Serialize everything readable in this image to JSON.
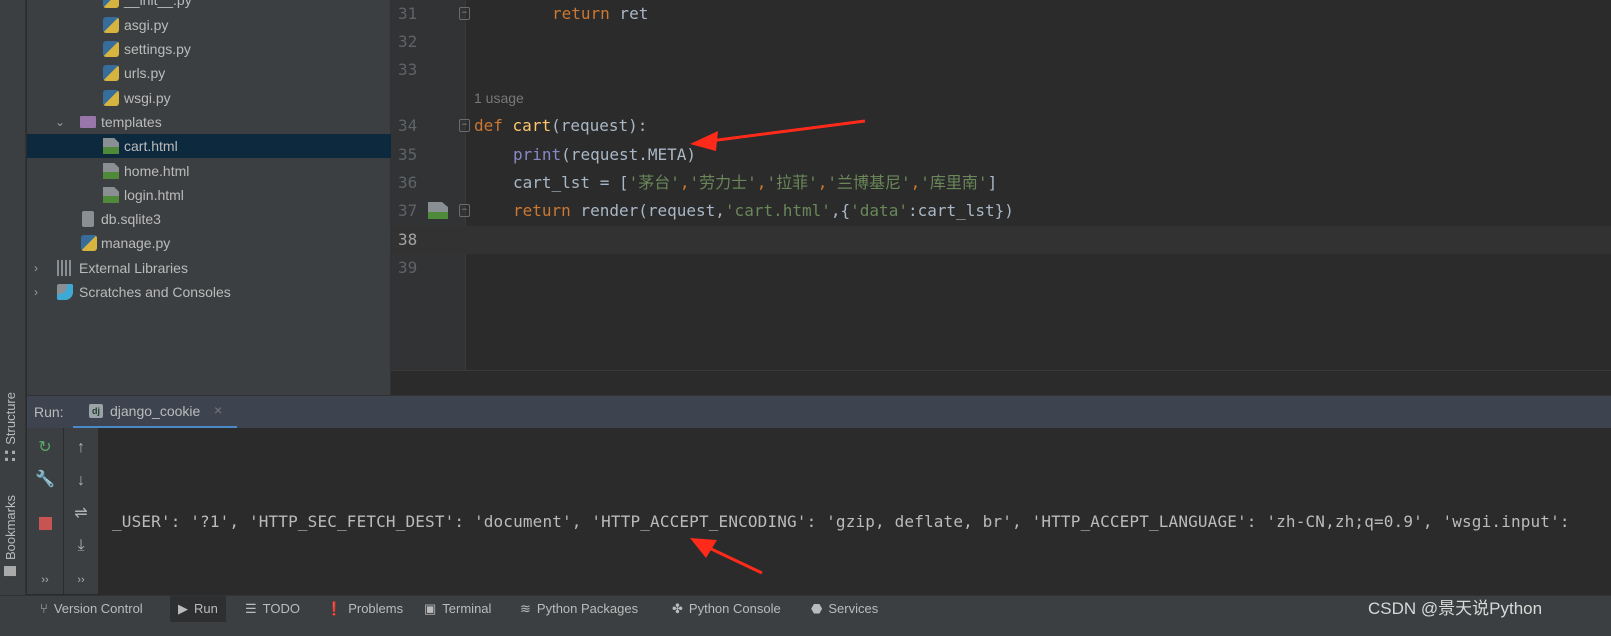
{
  "left_strip": {
    "structure": "Structure",
    "bookmarks": "Bookmarks"
  },
  "project_tree": [
    {
      "label": "__init__.py",
      "type": "python"
    },
    {
      "label": "asgi.py",
      "type": "python"
    },
    {
      "label": "settings.py",
      "type": "python"
    },
    {
      "label": "urls.py",
      "type": "python"
    },
    {
      "label": "wsgi.py",
      "type": "python"
    },
    {
      "label": "templates",
      "type": "folder",
      "expanded": true
    },
    {
      "label": "cart.html",
      "type": "html",
      "selected": true
    },
    {
      "label": "home.html",
      "type": "html"
    },
    {
      "label": "login.html",
      "type": "html"
    },
    {
      "label": "db.sqlite3",
      "type": "file"
    },
    {
      "label": "manage.py",
      "type": "python"
    },
    {
      "label": "External Libraries",
      "type": "libraries"
    },
    {
      "label": "Scratches and Consoles",
      "type": "scratches"
    }
  ],
  "editor": {
    "line_numbers": [
      "31",
      "32",
      "33",
      "34",
      "35",
      "36",
      "37",
      "38",
      "39"
    ],
    "usage_hint": "1 usage",
    "code": {
      "l31_kw": "return",
      "l31_rest": " ret",
      "l34_kw": "def",
      "l34_fn": "cart",
      "l34_rest": "(request):",
      "l35_bi": "print",
      "l35_rest": "(request.META)",
      "l36_a": "cart_lst = [",
      "l36_s1": "'茅台'",
      "l36_s2": "'劳力士'",
      "l36_s3": "'拉菲'",
      "l36_s4": "'兰博基尼'",
      "l36_s5": "'库里南'",
      "l36_end": "]",
      "l37_kw": "return",
      "l37_a": " render(request,",
      "l37_s1": "'cart.html'",
      "l37_b": ",{",
      "l37_s2": "'data'",
      "l37_c": ":cart_lst})",
      "comma": ","
    }
  },
  "run_panel": {
    "label": "Run:",
    "tab": "django_cookie",
    "output": "_USER': '?1', 'HTTP_SEC_FETCH_DEST': 'document', 'HTTP_ACCEPT_ENCODING': 'gzip, deflate, br', 'HTTP_ACCEPT_LANGUAGE': 'zh-CN,zh;q=0.9', 'wsgi.input':",
    "more": "››"
  },
  "status_bar": [
    {
      "label": "Version Control",
      "icon": "branch-icon"
    },
    {
      "label": "Run",
      "icon": "run-icon",
      "active": true
    },
    {
      "label": "TODO",
      "icon": "list-icon"
    },
    {
      "label": "Problems",
      "icon": "problems-icon"
    },
    {
      "label": "Terminal",
      "icon": "terminal-icon"
    },
    {
      "label": "Python Packages",
      "icon": "packages-icon"
    },
    {
      "label": "Python Console",
      "icon": "python-icon"
    },
    {
      "label": "Services",
      "icon": "services-icon"
    }
  ],
  "watermark": "CSDN @景天说Python",
  "colors": {
    "keyword": "#cc7832",
    "string": "#6a8759",
    "builtin": "#8888c6",
    "selection": "#0d293e",
    "annotation": "#ff2a1a"
  }
}
